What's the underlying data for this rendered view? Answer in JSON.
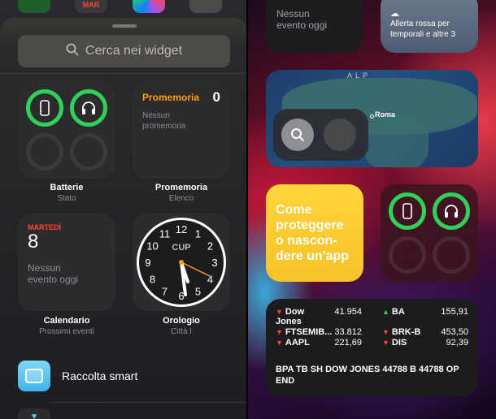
{
  "home_icons_peek": {
    "mini_calendar_month": "MAR"
  },
  "gallery": {
    "search_placeholder": "Cerca nei widget",
    "batteries": {
      "title": "Batterie",
      "subtitle": "Stato"
    },
    "reminders": {
      "header": "Promemoria",
      "count": "0",
      "empty": "Nessun promemoria",
      "title": "Promemoria",
      "subtitle": "Elenco"
    },
    "calendar": {
      "weekday": "MARTEDÌ",
      "day": "8",
      "empty_line1": "Nessun",
      "empty_line2": "evento oggi",
      "title": "Calendario",
      "subtitle": "Prossimi eventi"
    },
    "clock": {
      "city": "CUP",
      "numerals": [
        "12",
        "1",
        "2",
        "3",
        "4",
        "5",
        "6",
        "7",
        "8",
        "9",
        "10",
        "11"
      ],
      "title": "Orologio",
      "subtitle": "Città I"
    },
    "smart_stack": {
      "label": "Raccolta smart"
    }
  },
  "right": {
    "calendar_top": {
      "line1": "Nessun",
      "line2": "evento oggi"
    },
    "weather_top": {
      "alert": "Allerta rossa per temporali e altre 3"
    },
    "map": {
      "city": "Roma",
      "region_label": "ALP"
    },
    "tips": {
      "text": "Come proteggere o nascon- dere un'app"
    },
    "stocks": {
      "rows": [
        {
          "left": {
            "name": "Dow Jones",
            "value": "41.954",
            "dir": "down"
          },
          "right": {
            "name": "BA",
            "value": "155,91",
            "dir": "up"
          }
        },
        {
          "left": {
            "name": "FTSEMIB...",
            "value": "33.812",
            "dir": "down"
          },
          "right": {
            "name": "BRK-B",
            "value": "453,50",
            "dir": "down"
          }
        },
        {
          "left": {
            "name": "AAPL",
            "value": "221,69",
            "dir": "down"
          },
          "right": {
            "name": "DIS",
            "value": "92,39",
            "dir": "down"
          }
        }
      ],
      "ticker": "BPA TB SH DOW JONES 44788 B 44788 OP END"
    }
  },
  "colors": {
    "ring_green": "#30d158",
    "reminder_orange": "#ff9f0a",
    "calendar_red": "#ff453a",
    "stock_down": "#ff453a",
    "stock_up": "#30d158",
    "tips_yellow": "#ffd53a"
  }
}
